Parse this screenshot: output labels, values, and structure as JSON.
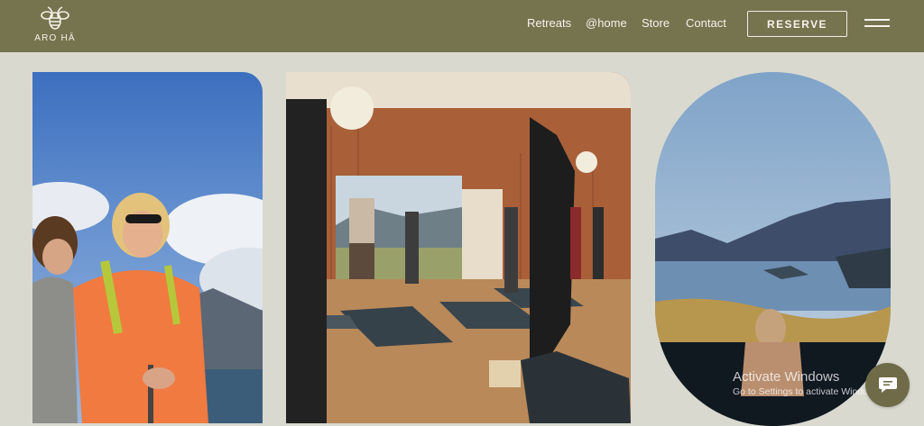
{
  "brand": {
    "name": "ARO HĀ",
    "icon": "bee-icon"
  },
  "nav": {
    "items": [
      {
        "label": "Retreats"
      },
      {
        "label": "@home"
      },
      {
        "label": "Store"
      },
      {
        "label": "Contact"
      }
    ],
    "reserve_label": "RESERVE",
    "menu_icon": "hamburger-menu-icon"
  },
  "watermark": {
    "title": "Activate Windows",
    "subtitle": "Go to Settings to activate Windows."
  },
  "chat": {
    "icon": "chat-bubble-icon"
  },
  "colors": {
    "nav_bg": "#76734f",
    "page_bg": "#d9d9d0",
    "accent": "#6f6b48"
  }
}
